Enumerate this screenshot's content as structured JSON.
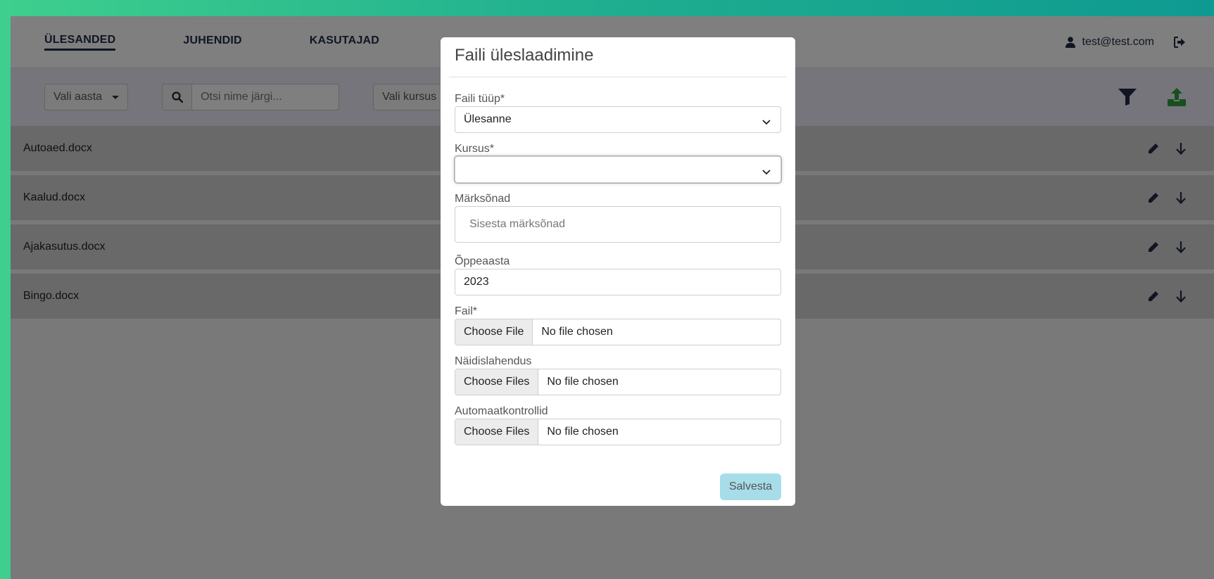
{
  "nav": {
    "items": [
      {
        "label": "ÜLESANDED",
        "active": true
      },
      {
        "label": "JUHENDID",
        "active": false
      },
      {
        "label": "KASUTAJAD",
        "active": false
      }
    ],
    "user_email": "test@test.com"
  },
  "toolbar": {
    "year_select": "Vali aasta",
    "search_placeholder": "Otsi nime järgi...",
    "course_select": "Vali kursus",
    "accent_color": "#2e9e3e"
  },
  "files": [
    {
      "name": "Autoaed.docx"
    },
    {
      "name": "Kaalud.docx"
    },
    {
      "name": "Ajakasutus.docx"
    },
    {
      "name": "Bingo.docx"
    }
  ],
  "modal": {
    "title": "Faili üleslaadimine",
    "file_type_label": "Faili tüüp*",
    "file_type_value": "Ülesanne",
    "course_label": "Kursus*",
    "course_value": "",
    "keywords_label": "Märksõnad",
    "keywords_placeholder": "Sisesta märksõnad",
    "year_label": "Õppeaasta",
    "year_value": "2023",
    "file_label": "Fail*",
    "file_button": "Choose File",
    "file_status": "No file chosen",
    "example_label": "Näidislahendus",
    "example_button": "Choose Files",
    "example_status": "No file chosen",
    "autotest_label": "Automaatkontrollid",
    "autotest_button": "Choose Files",
    "autotest_status": "No file chosen",
    "save_label": "Salvesta"
  }
}
